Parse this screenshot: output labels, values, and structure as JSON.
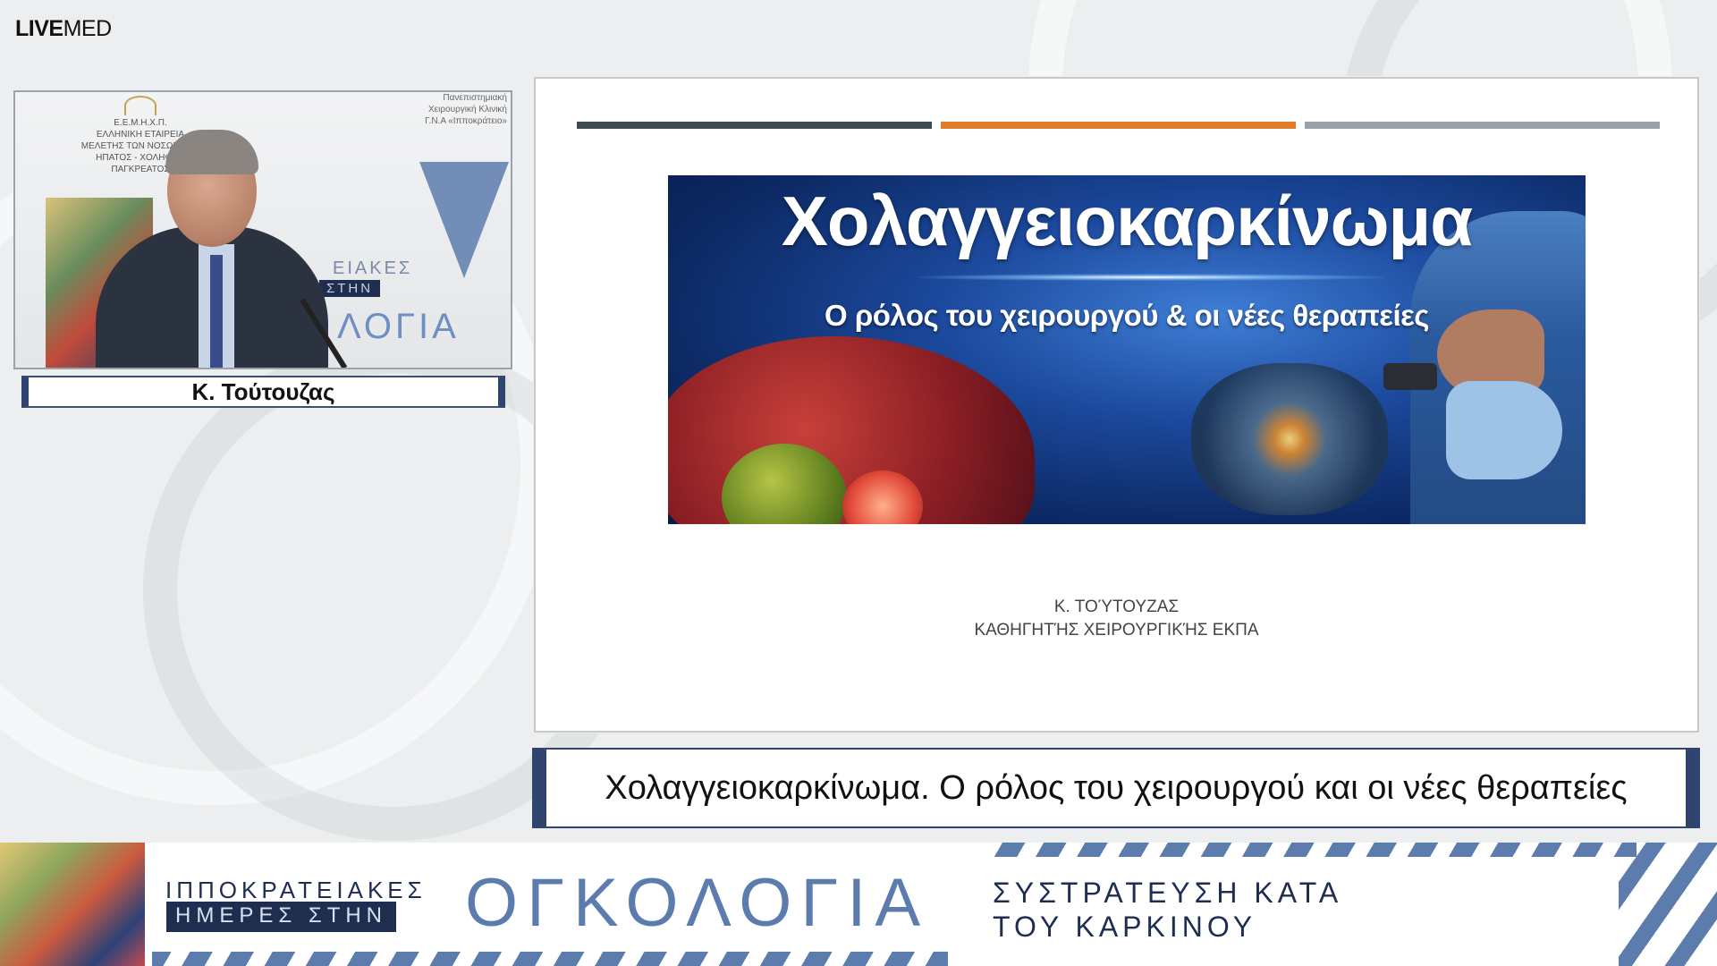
{
  "brand": {
    "logo_bold": "LIVE",
    "logo_rest": "MED"
  },
  "video": {
    "org_left": [
      "Ε.Ε.Μ.Η.Χ.Π.",
      "ΕΛΛΗΝΙΚΗ ΕΤΑΙΡΕΙΑ",
      "ΜΕΛΕΤΗΣ ΤΩΝ ΝΟΣΩΝ ΤΟΥ",
      "ΗΠΑΤΟΣ - ΧΟΛΗΦΟΡ",
      "ΠΑΓΚΡΕΑΤΟΣ"
    ],
    "org_right": [
      "Πανεπιστημιακή",
      "Χειρουργική Κλινική",
      "Γ.Ν.Α «Ιπποκράτειο»"
    ],
    "bg_text_1": "ΕΙΑΚΕΣ",
    "bg_text_2": "ΣΤΗΝ",
    "bg_text_3": "ΛΟΓΙΑ"
  },
  "speaker": {
    "name": "Κ. Τούτουζας"
  },
  "slide": {
    "banner_title": "Χολαγγειοκαρκίνωμα",
    "banner_subtitle": "Ο ρόλος του χειρουργού & οι νέες θεραπείες",
    "author_name": "Κ. ΤΟΎΤΟΥΖΑΣ",
    "author_title": "ΚΑΘΗΓΗΤΉΣ ΧΕΙΡΟΥΡΓΙΚΉΣ ΕΚΠΑ",
    "stripe_colors": [
      "#3f4a50",
      "#e07b2a",
      "#9aa0a5"
    ]
  },
  "lower_third": {
    "title": "Χολαγγειοκαρκίνωμα. Ο ρόλος του χειρουργού και οι νέες θεραπείες"
  },
  "footer": {
    "event_line1": "ΙΠΠΟΚΡΑΤΕΙΑΚΕΣ",
    "event_line2": "ΗΜΕΡΕΣ ΣΤΗΝ",
    "event_big": "ΟΓΚΟΛΟΓΙΑ",
    "slogan_line1": "ΣΥΣΤΡΑΤΕΥΣΗ ΚΑΤΑ",
    "slogan_line2": "ΤΟΥ ΚΑΡΚΙΝΟΥ"
  },
  "colors": {
    "accent_navy": "#2f4570",
    "accent_blue": "#5c7cae",
    "accent_orange": "#e07b2a"
  }
}
